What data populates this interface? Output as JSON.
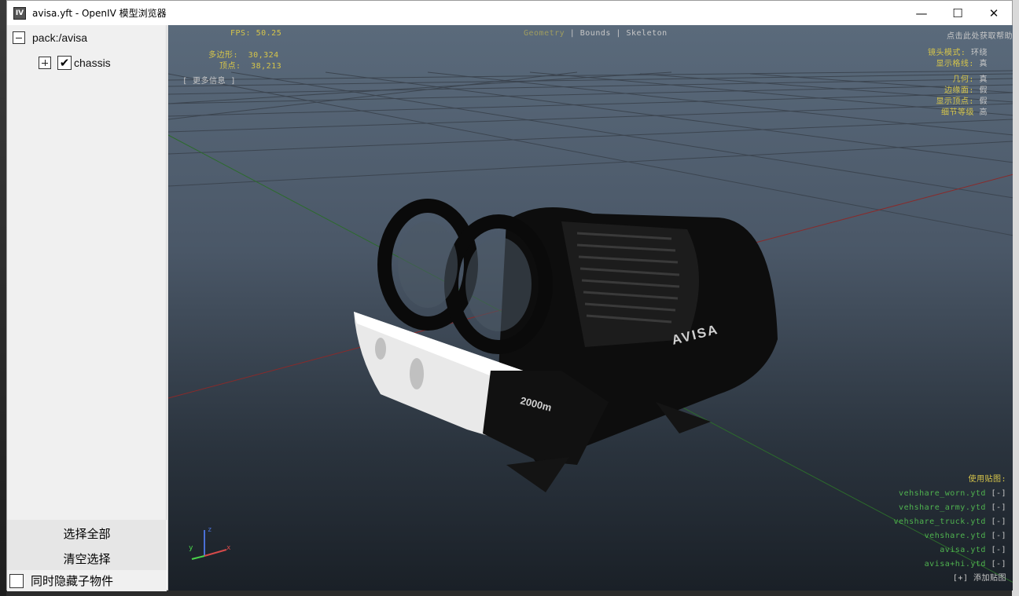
{
  "window": {
    "icon_label": "IV",
    "title": "avisa.yft - OpenIV 模型浏览器",
    "min_glyph": "—",
    "max_glyph": "☐",
    "close_glyph": "✕"
  },
  "sidebar": {
    "root_label": "pack:/avisa",
    "child_label": "chassis",
    "check_glyph": "✔",
    "select_all": "选择全部",
    "clear_selection": "清空选择",
    "hide_children": "同时隐藏子物件"
  },
  "viewport": {
    "fps_label": "FPS:",
    "fps_value": "50.25",
    "tabs": [
      "Geometry",
      "Bounds",
      "Skeleton"
    ],
    "tab_sep": "|",
    "active_tab": "Geometry",
    "help_link": "点击此处获取帮助",
    "polys_label": "多边形:",
    "polys_value": "30,324",
    "verts_label": "顶点:",
    "verts_value": "38,213",
    "more_info": "[ 更多信息 ]",
    "settings": [
      {
        "label": "镜头模式:",
        "value": "环绕"
      },
      {
        "label": "显示格线:",
        "value": "真"
      },
      {
        "label": "几何:",
        "value": "真"
      },
      {
        "label": "边缘面:",
        "value": "假"
      },
      {
        "label": "显示顶点:",
        "value": "假"
      },
      {
        "label": "细节等级",
        "value": "高"
      }
    ],
    "textures_header": "使用贴图:",
    "textures": [
      {
        "name": "vehshare_worn.ytd",
        "action": "[-]"
      },
      {
        "name": "vehshare_army.ytd",
        "action": "[-]"
      },
      {
        "name": "vehshare_truck.ytd",
        "action": "[-]"
      },
      {
        "name": "vehshare.ytd",
        "action": "[-]"
      },
      {
        "name": "avisa.ytd",
        "action": "[-]"
      },
      {
        "name": "avisa+hi.ytd",
        "action": "[-]"
      }
    ],
    "add_texture_btn": "[+]",
    "add_texture_label": "添加贴图",
    "model_logo": "AVISA",
    "model_depth": "2000m",
    "axis_x": "x",
    "axis_y": "y",
    "axis_z": "z"
  }
}
